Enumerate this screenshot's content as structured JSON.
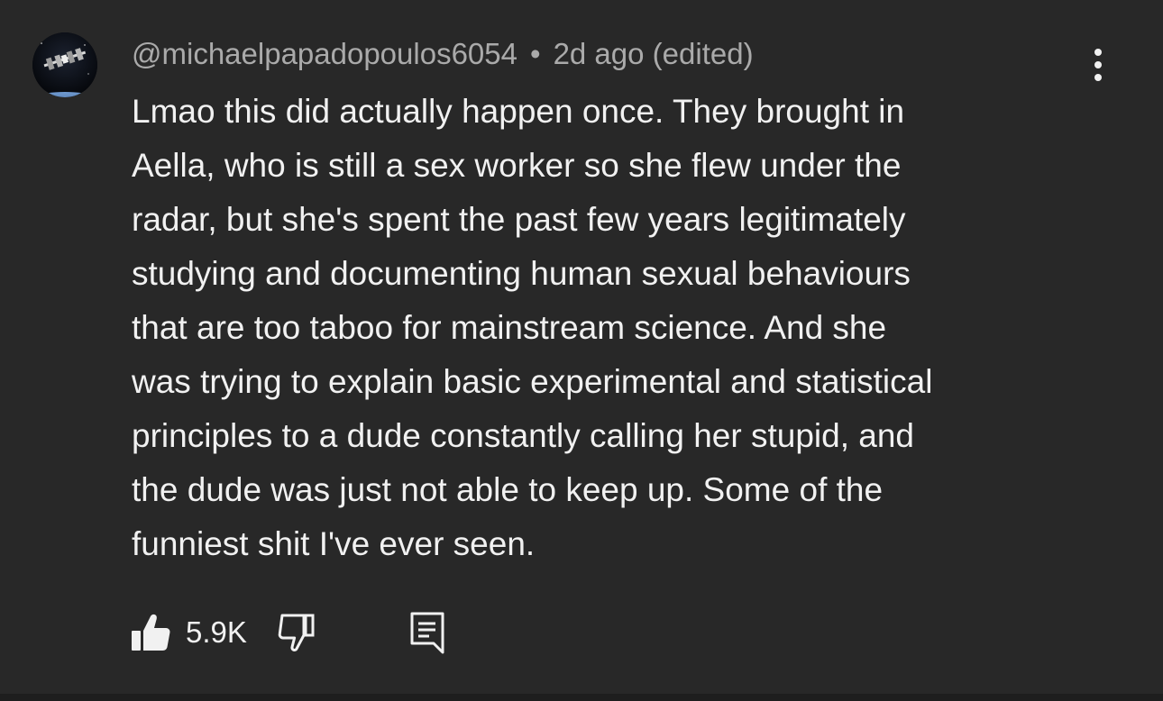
{
  "comment": {
    "author": "@michaelpapadopoulos6054",
    "separator": "•",
    "time": "2d ago (edited)",
    "text": "Lmao this did actually happen once. They brought in\nAella, who is still a sex worker so she flew under the\nradar, but she's spent the past few years legitimately\nstudying and documenting human sexual behaviours\nthat are too taboo for mainstream science. And she\nwas trying to explain basic experimental and statistical\nprinciples to a dude constantly calling her stupid, and\nthe dude was just not able to keep up.  Some of the\nfunniest shit I've ever seen.",
    "like_count": "5.9K",
    "liked": true
  },
  "icons": {
    "avatar": "space-station-avatar",
    "more": "more-vertical-icon",
    "like": "thumbs-up-filled-icon",
    "dislike": "thumbs-down-outline-icon",
    "reply": "comment-reply-icon"
  },
  "colors": {
    "background": "#282828",
    "text": "#f1f1f1",
    "secondary_text": "#aaaaaa"
  }
}
